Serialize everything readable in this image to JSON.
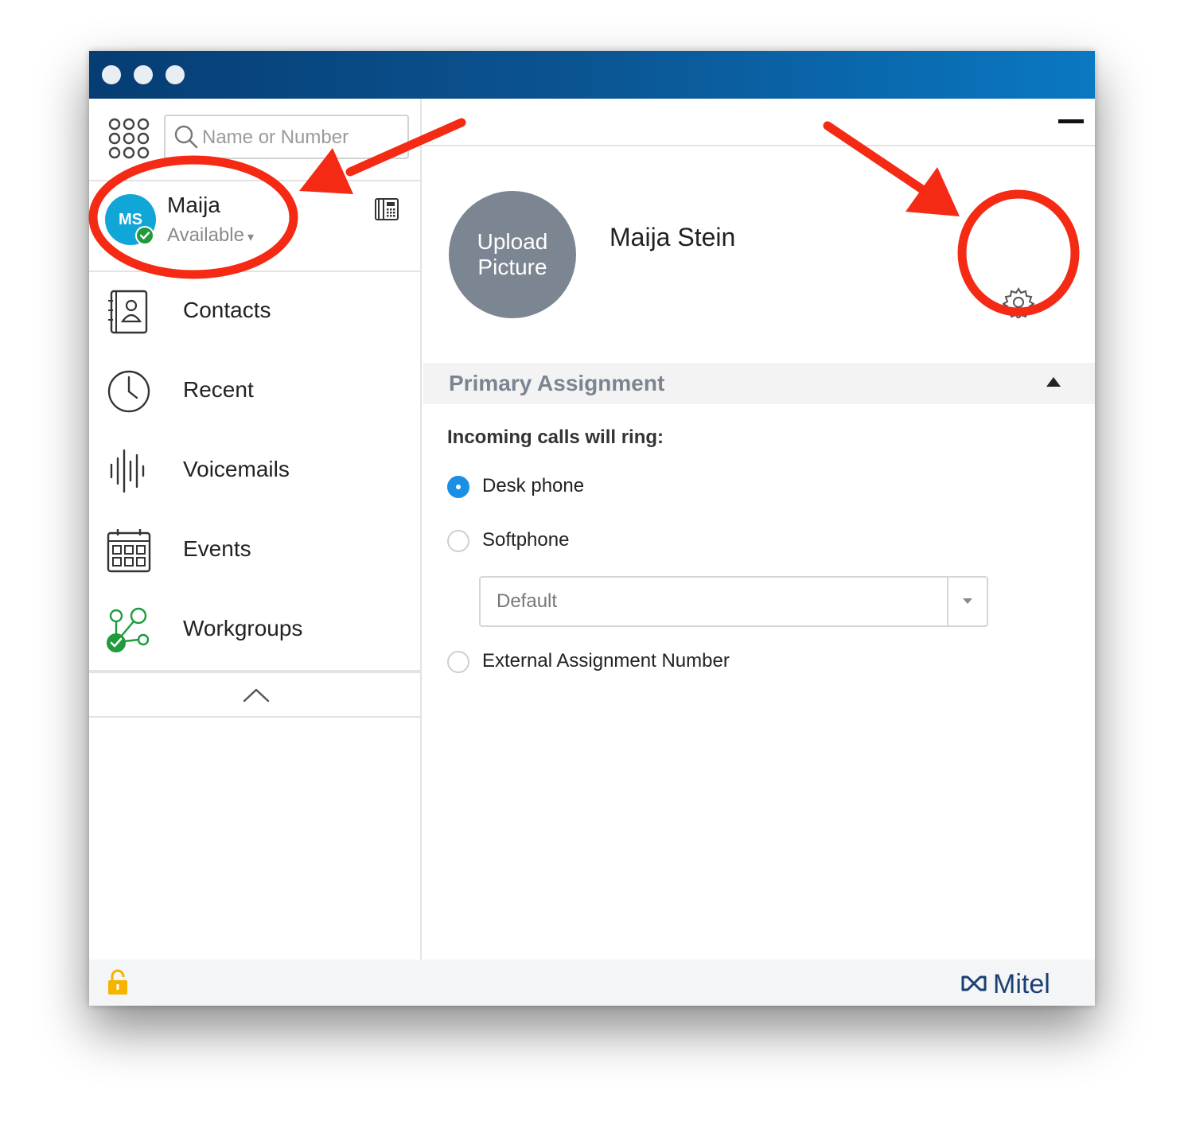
{
  "search": {
    "placeholder": "Name or Number"
  },
  "user": {
    "initials": "MS",
    "short_name": "Maija",
    "status": "Available",
    "status_caret": "▾"
  },
  "nav": [
    {
      "label": "Contacts",
      "icon": "contacts-icon"
    },
    {
      "label": "Recent",
      "icon": "clock-icon"
    },
    {
      "label": "Voicemails",
      "icon": "voicemail-icon"
    },
    {
      "label": "Events",
      "icon": "calendar-icon"
    },
    {
      "label": "Workgroups",
      "icon": "workgroups-icon"
    }
  ],
  "profile": {
    "upload_line1": "Upload",
    "upload_line2": "Picture",
    "full_name": "Maija Stein"
  },
  "assignment": {
    "section_title": "Primary Assignment",
    "prompt": "Incoming calls will ring:",
    "options": [
      {
        "label": "Desk phone",
        "selected": true
      },
      {
        "label": "Softphone",
        "selected": false
      },
      {
        "label": "External Assignment Number",
        "selected": false
      }
    ],
    "softphone_select_value": "Default"
  },
  "footer": {
    "brand": "Mitel"
  },
  "colors": {
    "titlebar_start": "#063d73",
    "titlebar_end": "#0a78c2",
    "avatar": "#10a7d8",
    "presence": "#1f9b3b",
    "radio_selected": "#1a8fe3",
    "annotation": "#f42a14",
    "lock": "#f5b400",
    "brand": "#1c3f73"
  }
}
